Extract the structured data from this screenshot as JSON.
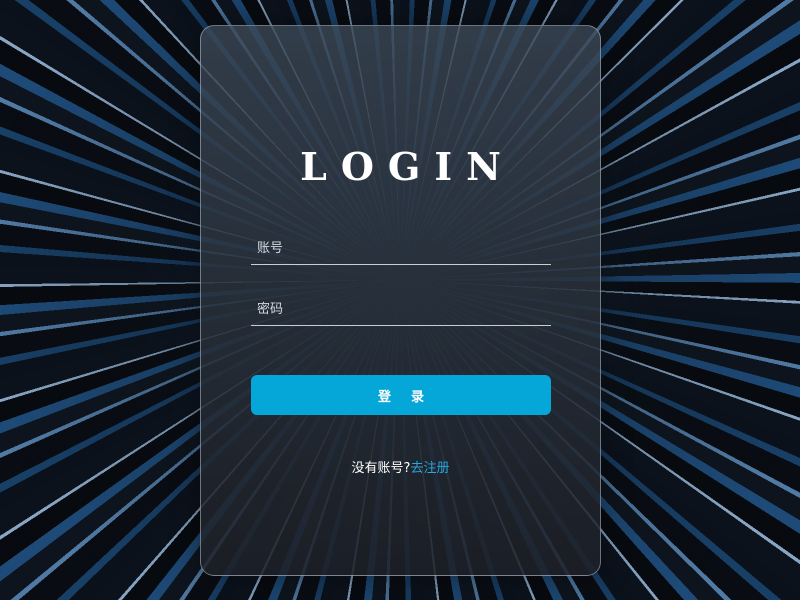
{
  "login": {
    "title": "LOGIN",
    "username_placeholder": "账号",
    "password_placeholder": "密码",
    "submit_label_first": "登",
    "submit_label_second": "录",
    "no_account_text": "没有账号?",
    "register_link": "去注册"
  },
  "colors": {
    "button": "#05a6d8",
    "link": "#27a8df",
    "title": "#ffffff"
  }
}
